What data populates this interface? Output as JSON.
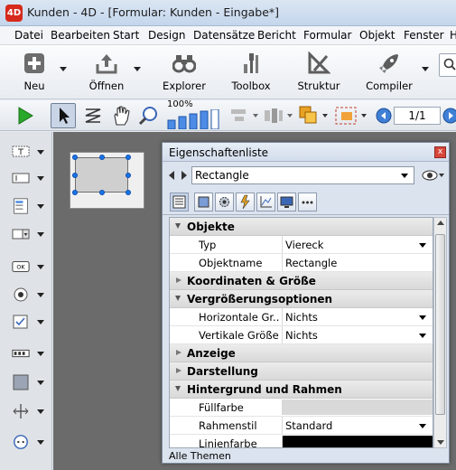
{
  "window": {
    "title": "Kunden - 4D - [Formular: Kunden -  Eingabe*]",
    "app_icon": "4D"
  },
  "menu": [
    "Datei",
    "Bearbeiten",
    "Start",
    "Design",
    "Datensätze",
    "Bericht",
    "Formular",
    "Objekt",
    "Fenster",
    "H"
  ],
  "toolbar": {
    "items": [
      {
        "label": "Neu",
        "icon": "plus-icon"
      },
      {
        "label": "Öffnen",
        "icon": "open-tray-icon"
      },
      {
        "label": "Explorer",
        "icon": "binoculars-icon"
      },
      {
        "label": "Toolbox",
        "icon": "tools-icon"
      },
      {
        "label": "Struktur",
        "icon": "structure-icon"
      },
      {
        "label": "Compiler",
        "icon": "rocket-icon"
      }
    ]
  },
  "toolbar2": {
    "zoom_label": "100%",
    "page_indicator": "1/1"
  },
  "properties": {
    "title": "Eigenschaftenliste",
    "selected_object": "Rectangle",
    "close_glyph": "x",
    "sections": [
      {
        "label": "Objekte",
        "expanded": true
      },
      {
        "label": "Koordinaten & Größe",
        "expanded": false
      },
      {
        "label": "Vergrößerungsoptionen",
        "expanded": true
      },
      {
        "label": "Anzeige",
        "expanded": false
      },
      {
        "label": "Darstellung",
        "expanded": false
      },
      {
        "label": "Hintergrund und Rahmen",
        "expanded": true
      }
    ],
    "rows": [
      {
        "name": "Typ",
        "value": "Viereck",
        "dropdown": true
      },
      {
        "name": "Objektname",
        "value": "Rectangle",
        "dropdown": false
      },
      {
        "name": "Horizontale Gr...",
        "value": "Nichts",
        "dropdown": true
      },
      {
        "name": "Vertikale Größe",
        "value": "Nichts",
        "dropdown": true
      },
      {
        "name": "Füllfarbe",
        "value": "",
        "dropdown": false,
        "swatch": "#d9d9d9"
      },
      {
        "name": "Rahmenstil",
        "value": "Standard",
        "dropdown": true
      },
      {
        "name": "Linienfarbe",
        "value": "",
        "dropdown": false,
        "swatch": "#000000"
      }
    ],
    "footer": "Alle Themen"
  },
  "colors": {
    "accent": "#1a73e8",
    "close": "#d8473a",
    "canvas": "#6b6b6b"
  }
}
